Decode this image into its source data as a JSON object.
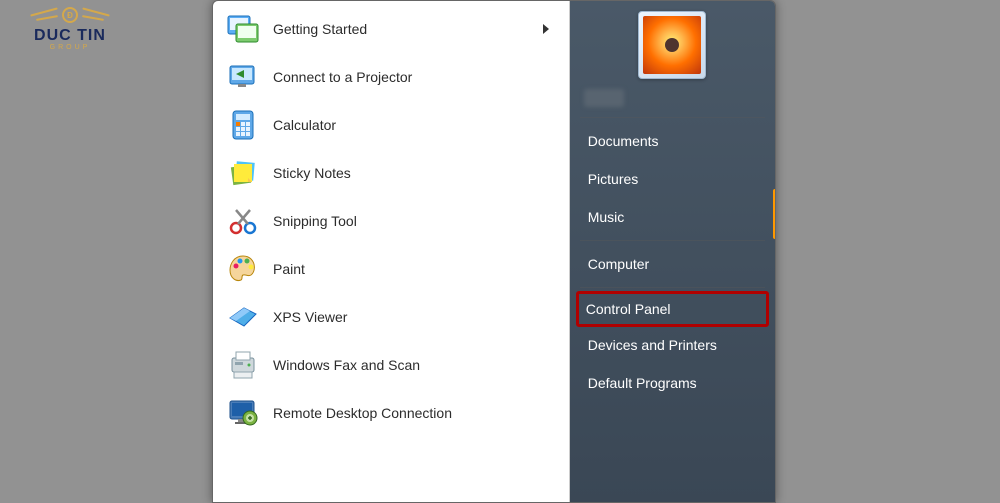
{
  "logo": {
    "brand": "DUC TIN",
    "subtitle": "GROUP"
  },
  "start_menu": {
    "programs": [
      {
        "label": "Getting Started",
        "icon": "getting-started-icon",
        "has_submenu": true
      },
      {
        "label": "Connect to a Projector",
        "icon": "projector-icon",
        "has_submenu": false
      },
      {
        "label": "Calculator",
        "icon": "calculator-icon",
        "has_submenu": false
      },
      {
        "label": "Sticky Notes",
        "icon": "sticky-notes-icon",
        "has_submenu": false
      },
      {
        "label": "Snipping Tool",
        "icon": "snipping-tool-icon",
        "has_submenu": false
      },
      {
        "label": "Paint",
        "icon": "paint-icon",
        "has_submenu": false
      },
      {
        "label": "XPS Viewer",
        "icon": "xps-viewer-icon",
        "has_submenu": false
      },
      {
        "label": "Windows Fax and Scan",
        "icon": "fax-scan-icon",
        "has_submenu": false
      },
      {
        "label": "Remote Desktop Connection",
        "icon": "remote-desktop-icon",
        "has_submenu": false
      }
    ],
    "side_items": [
      {
        "label": "Documents",
        "highlighted": false
      },
      {
        "label": "Pictures",
        "highlighted": false
      },
      {
        "label": "Music",
        "highlighted": false
      },
      {
        "label": "Computer",
        "highlighted": false
      },
      {
        "label": "Control Panel",
        "highlighted": true
      },
      {
        "label": "Devices and Printers",
        "highlighted": false
      },
      {
        "label": "Default Programs",
        "highlighted": false
      }
    ]
  }
}
